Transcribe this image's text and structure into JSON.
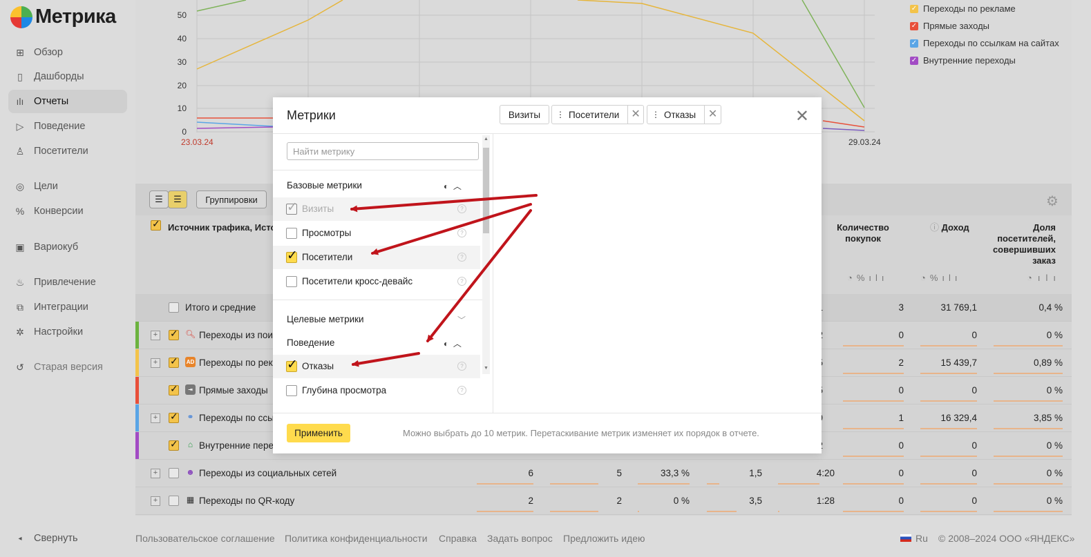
{
  "app": {
    "logo_text": "Метрика"
  },
  "sidebar": {
    "items": [
      {
        "label": "Обзор",
        "icon": "grid-icon"
      },
      {
        "label": "Дашборды",
        "icon": "dashboard-icon"
      },
      {
        "label": "Отчеты",
        "icon": "reports-icon",
        "active": true
      },
      {
        "label": "Поведение",
        "icon": "play-icon"
      },
      {
        "label": "Посетители",
        "icon": "user-icon"
      },
      {
        "label": "Цели",
        "icon": "target-icon"
      },
      {
        "label": "Конверсии",
        "icon": "percent-icon"
      },
      {
        "label": "Вариокуб",
        "icon": "cube-icon"
      },
      {
        "label": "Привлечение",
        "icon": "flame-icon"
      },
      {
        "label": "Интеграции",
        "icon": "puzzle-icon"
      },
      {
        "label": "Настройки",
        "icon": "gear-icon"
      },
      {
        "label": "Старая версия",
        "icon": "undo-icon"
      }
    ],
    "collapse_label": "Свернуть"
  },
  "chart": {
    "y_ticks": [
      "50",
      "40",
      "30",
      "20",
      "10",
      "0"
    ],
    "x_start": "23.03.24",
    "x_end": "29.03.24",
    "legend": [
      {
        "label": "Переходы по рекламе",
        "color": "#f3c34a"
      },
      {
        "label": "Прямые заходы",
        "color": "#e8503a"
      },
      {
        "label": "Переходы по ссылкам на сайтах",
        "color": "#5aa5e6"
      },
      {
        "label": "Внутренние переходы",
        "color": "#a24bc4"
      }
    ]
  },
  "toolbar": {
    "group_label": "Группировки"
  },
  "table": {
    "source_header": "Источник трафика, Исто",
    "col_headers": {
      "purchases": "Количество покупок",
      "revenue": "Доход",
      "share": "Доля посетителей, совершивших заказ"
    },
    "total_row": {
      "label": "Итого и средние",
      "partial": "1",
      "purchases": "3",
      "revenue": "31 769,1",
      "share": "0,4 %"
    },
    "rows": [
      {
        "label": "Переходы из поис",
        "partial": "2",
        "purchases": "0",
        "revenue": "0",
        "share": "0 %",
        "color": "#6cb33f",
        "icon": "search-icon",
        "checked": true,
        "plus": true
      },
      {
        "label": "Переходы по рекл",
        "partial": "5",
        "purchases": "2",
        "revenue": "15 439,7",
        "share": "0,89 %",
        "color": "#f3c34a",
        "icon": "ad-icon",
        "checked": true,
        "plus": true
      },
      {
        "label": "Прямые заходы",
        "partial": "5",
        "purchases": "0",
        "revenue": "0",
        "share": "0 %",
        "color": "#e8503a",
        "icon": "enter-icon",
        "checked": true,
        "plus": false
      },
      {
        "label": "Переходы по ссыл",
        "partial": "9",
        "purchases": "1",
        "revenue": "16 329,4",
        "share": "3,85 %",
        "color": "#5aa5e6",
        "icon": "link-icon",
        "checked": true,
        "plus": true
      },
      {
        "label": "Внутренние перех",
        "partial": "2",
        "purchases": "0",
        "revenue": "0",
        "share": "0 %",
        "color": "#a24bc4",
        "icon": "home-icon",
        "checked": true,
        "plus": false
      },
      {
        "label": "Переходы из социальных сетей",
        "c1": "6",
        "c2": "5",
        "c3": "33,3 %",
        "c4": "1,5",
        "c5": "4:20",
        "purchases": "0",
        "revenue": "0",
        "share": "0 %",
        "icon": "social-icon",
        "checked": false,
        "plus": true
      },
      {
        "label": "Переходы по QR-коду",
        "c1": "2",
        "c2": "2",
        "c3": "0 %",
        "c4": "3,5",
        "c5": "1:28",
        "purchases": "0",
        "revenue": "0",
        "share": "0 %",
        "icon": "qr-icon",
        "checked": false,
        "plus": true
      }
    ]
  },
  "modal": {
    "title": "Метрики",
    "search_placeholder": "Найти метрику",
    "groups": {
      "base": "Базовые метрики",
      "target": "Целевые метрики",
      "behavior": "Поведение"
    },
    "base_metrics": [
      {
        "label": "Визиты",
        "checked": true,
        "disabled": true
      },
      {
        "label": "Просмотры",
        "checked": false
      },
      {
        "label": "Посетители",
        "checked": true
      },
      {
        "label": "Посетители кросс-девайс",
        "checked": false
      }
    ],
    "behavior_metrics": [
      {
        "label": "Отказы",
        "checked": true
      },
      {
        "label": "Глубина просмотра",
        "checked": false
      }
    ],
    "chips": [
      "Визиты",
      "Посетители",
      "Отказы"
    ],
    "apply_label": "Применить",
    "hint": "Можно выбрать до 10 метрик. Перетаскивание метрик изменяет их порядок в отчете."
  },
  "footer": {
    "links": [
      "Пользовательское соглашение",
      "Политика конфиденциальности",
      "Справка",
      "Задать вопрос",
      "Предложить идею"
    ],
    "lang": "Ru",
    "copyright": "© 2008–2024 ООО «ЯНДЕКС»"
  }
}
